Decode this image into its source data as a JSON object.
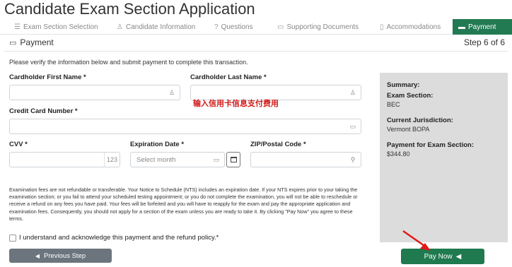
{
  "app_title": "Candidate Exam Section Application",
  "tabs": [
    {
      "label": "Exam Section Selection",
      "icon": "list-icon"
    },
    {
      "label": "Candidate Information",
      "icon": "person-icon"
    },
    {
      "label": "Questions",
      "icon": "question-icon"
    },
    {
      "label": "Supporting Documents",
      "icon": "folder-icon"
    },
    {
      "label": "Accommodations",
      "icon": "clipboard-icon"
    },
    {
      "label": "Payment",
      "icon": "credit-card-icon",
      "active": true
    }
  ],
  "section": {
    "title": "Payment",
    "step": "Step 6 of 6"
  },
  "intro": "Please verify the information below and submit payment to complete this transaction.",
  "form": {
    "first_name_label": "Cardholder First Name *",
    "last_name_label": "Cardholder Last Name *",
    "card_number_label": "Credit Card Number *",
    "cvv_label": "CVV *",
    "cvv_suffix": "123",
    "expiration_label": "Expiration Date *",
    "expiration_placeholder": "Select month",
    "zip_label": "ZIP/Postal Code *"
  },
  "annotation_text": "输入信用卡信息支付费用",
  "summary": {
    "title": "Summary:",
    "exam_section_label": "Exam Section:",
    "exam_section_value": "BEC",
    "jurisdiction_label": "Current Jurisdiction:",
    "jurisdiction_value": "Vermont BOPA",
    "payment_label": "Payment for Exam Section:",
    "payment_value": "$344.80"
  },
  "disclaimer": "Examination fees are not refundable or transferable. Your Notice to Schedule (NTS) includes an expiration date. If your NTS expires prior to your taking the examination section; or you fail to attend your scheduled testing appointment; or you do not complete the examination, you will not be able to reschedule or receive a refund on any fees you have paid. Your fees will be forfeited and you will have to reapply for the exam and pay the appropriate application and examination fees. Consequently, you should not apply for a section of the exam unless you are ready to take it. By clicking \"Pay Now\" you agree to these terms.",
  "acknowledge_label": "I understand and acknowledge this payment and the refund policy.*",
  "buttons": {
    "previous": "Previous Step",
    "pay_now": "Pay Now"
  },
  "colors": {
    "accent": "#1f7a4f",
    "annotation": "#d11a1a",
    "secondary": "#6c757d",
    "summary_bg": "#dcdcdc"
  }
}
